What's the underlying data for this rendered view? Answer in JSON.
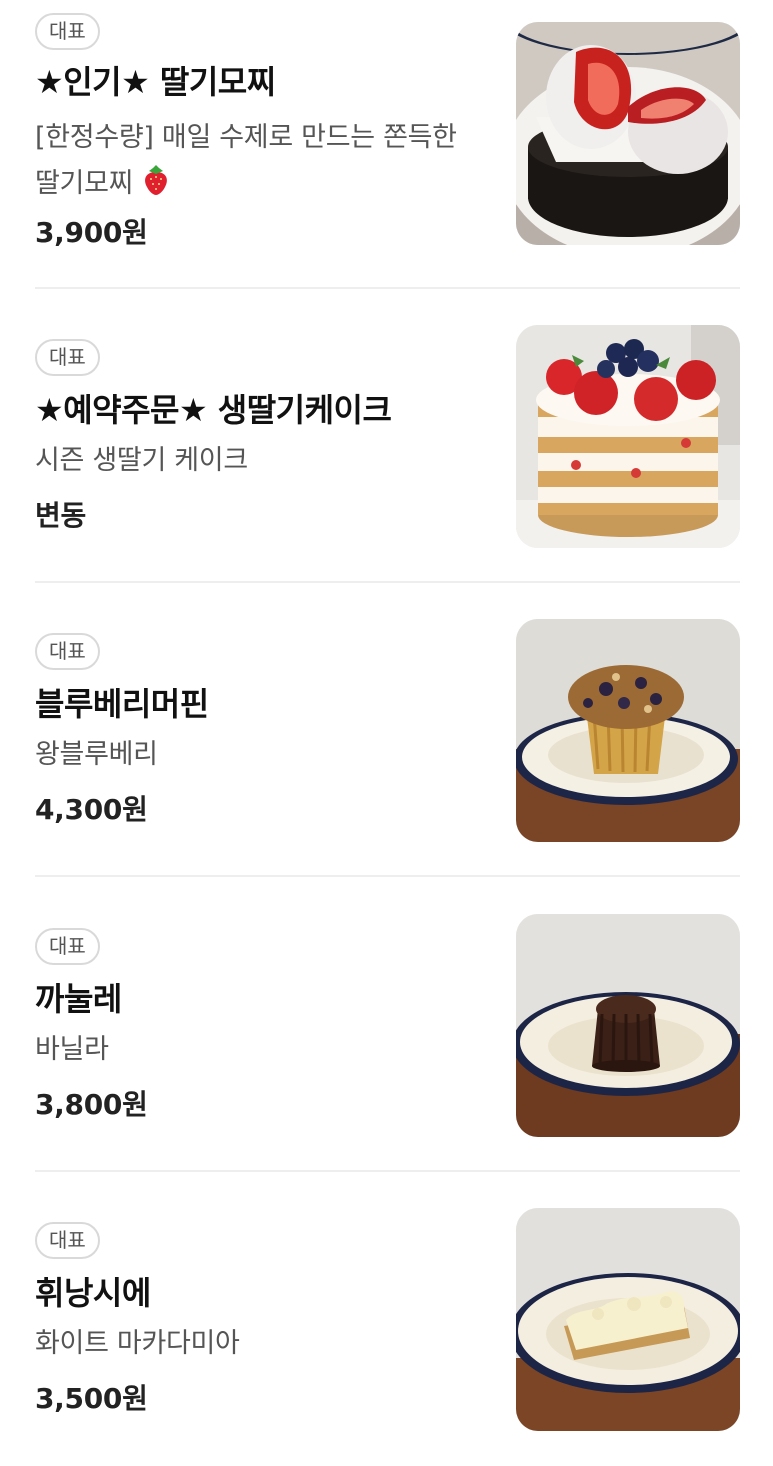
{
  "menu": {
    "items": [
      {
        "badge": "대표",
        "name": "★인기★ 딸기모찌",
        "description": "[한정수량] 매일 수제로 만드는 쫀득한 딸기모찌",
        "description_icon": "strawberry-emoji",
        "price": "3,900원",
        "image": "strawberry-mochi-photo"
      },
      {
        "badge": "대표",
        "name": "★예약주문★ 생딸기케이크",
        "description": "시즌 생딸기 케이크",
        "price": "변동",
        "image": "strawberry-cake-photo"
      },
      {
        "badge": "대표",
        "name": "블루베리머핀",
        "description": "왕블루베리",
        "price": "4,300원",
        "image": "blueberry-muffin-photo"
      },
      {
        "badge": "대표",
        "name": "까눌레",
        "description": "바닐라",
        "price": "3,800원",
        "image": "canele-photo"
      },
      {
        "badge": "대표",
        "name": "휘낭시에",
        "description": "화이트 마카다미아",
        "price": "3,500원",
        "image": "financier-photo"
      }
    ]
  }
}
